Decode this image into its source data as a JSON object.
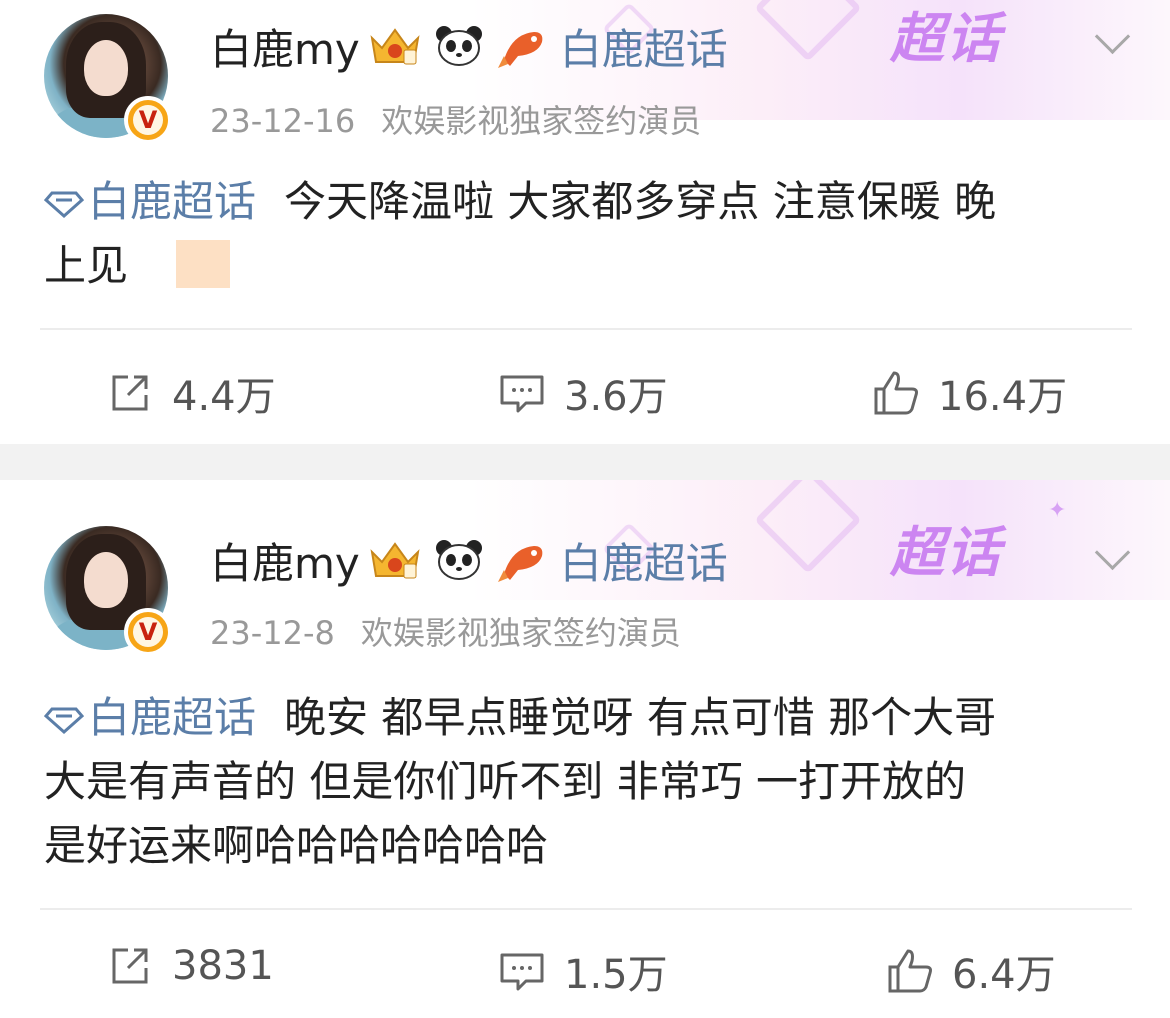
{
  "posts": [
    {
      "username": "白鹿my",
      "header_topic": "白鹿超话",
      "date": "23-12-16",
      "source": "欢娱影视独家签约演员",
      "topic": "白鹿超话",
      "text_line1": "今天降温啦 大家都多穿点 注意保暖 晚",
      "text_line2": "上见",
      "banner_label": "超话",
      "reposts": "4.4万",
      "comments": "3.6万",
      "likes": "16.4万",
      "verified_badge": "V"
    },
    {
      "username": "白鹿my",
      "header_topic": "白鹿超话",
      "date": "23-12-8",
      "source": "欢娱影视独家签约演员",
      "topic": "白鹿超话",
      "text_line1": "晚安 都早点睡觉呀 有点可惜 那个大哥",
      "text_line2": "大是有声音的 但是你们听不到 非常巧 一打开放的",
      "text_line3": "是好运来啊哈哈哈哈哈哈哈",
      "banner_label": "超话",
      "reposts": "3831",
      "comments": "1.5万",
      "likes": "6.4万",
      "verified_badge": "V"
    }
  ],
  "colors": {
    "topic_link": "#5b7ea8",
    "banner_text": "#c87bf1",
    "verified_badge": "#f7a516",
    "separator": "#f2f2f2"
  },
  "icons": [
    "crown-level-icon",
    "panda-icon",
    "koi-fish-icon",
    "super-topic-diamond-icon",
    "repost-icon",
    "comment-icon",
    "like-icon",
    "chevron-down-icon"
  ]
}
